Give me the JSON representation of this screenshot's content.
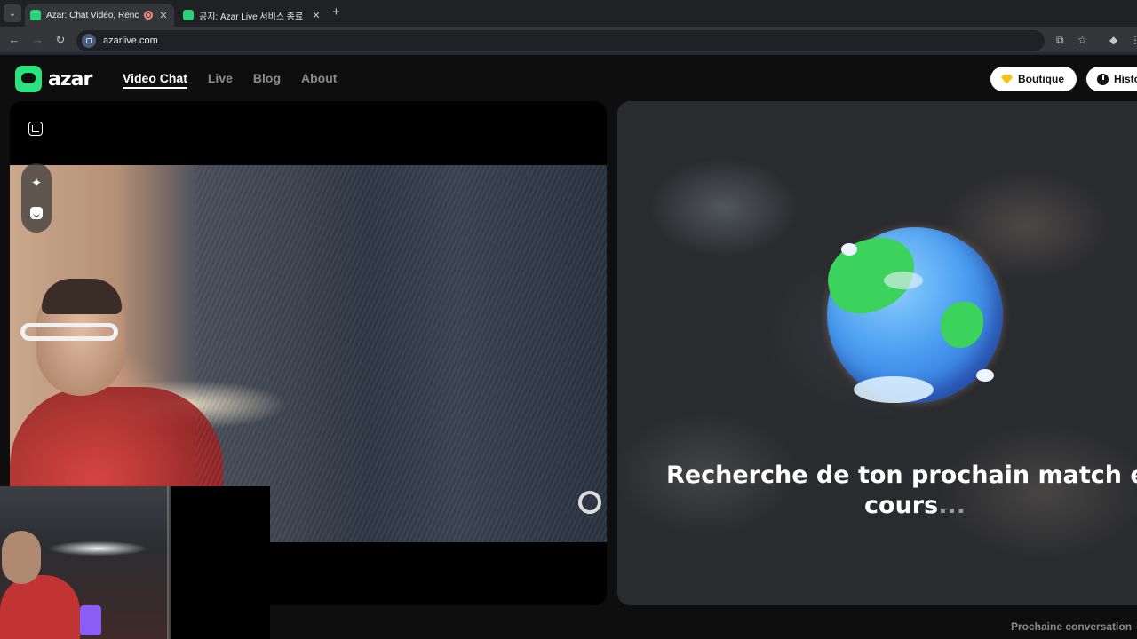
{
  "browser": {
    "tabs": [
      {
        "title": "Azar: Chat Vidéo, Rencontre",
        "active": true
      },
      {
        "title": "공지: Azar Live 서비스 종료",
        "active": false
      }
    ],
    "url": "azarlive.com"
  },
  "header": {
    "logo_text": "azar",
    "nav": [
      "Video Chat",
      "Live",
      "Blog",
      "About"
    ],
    "active_nav": "Video Chat",
    "boutique_label": "Boutique",
    "history_label": "Histo"
  },
  "search": {
    "status_text": "Recherche de ton prochain match en",
    "status_text_2": "cours",
    "dots": "..."
  },
  "footer": {
    "next_label": "Prochaine conversation"
  },
  "colors": {
    "brand_green": "#2be37c",
    "gem": "#f7c31b"
  }
}
